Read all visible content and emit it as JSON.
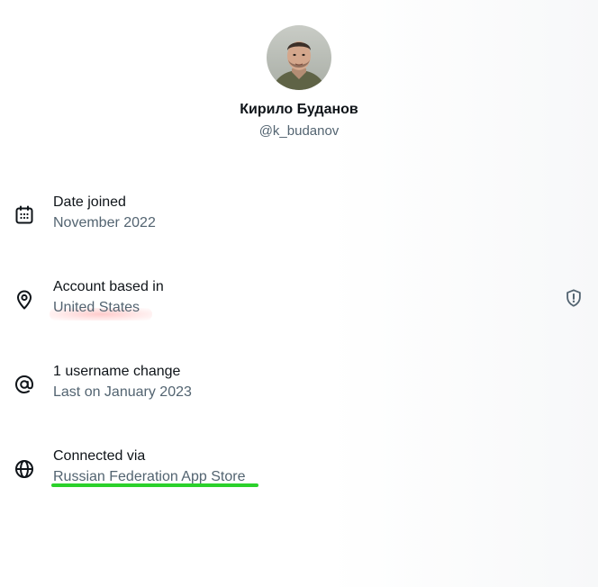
{
  "profile": {
    "display_name": "Кирило Буданов",
    "handle": "@k_budanov"
  },
  "about_rows": [
    {
      "icon": "calendar-icon",
      "title": "Date joined",
      "value": "November 2022"
    },
    {
      "icon": "location-pin-icon",
      "title": "Account based in",
      "value": "United States",
      "end_icon": "shield-alert-icon",
      "annotation": "red-highlight"
    },
    {
      "icon": "at-sign-icon",
      "title": "1 username change",
      "value": "Last on January 2023"
    },
    {
      "icon": "globe-icon",
      "title": "Connected via",
      "value": "Russian Federation App Store",
      "annotation": "green-underline"
    }
  ],
  "colors": {
    "primary_text": "#0f1419",
    "secondary_text": "#536471",
    "highlight_red": "#ff8c8c",
    "underline_green": "#2bd12b"
  }
}
